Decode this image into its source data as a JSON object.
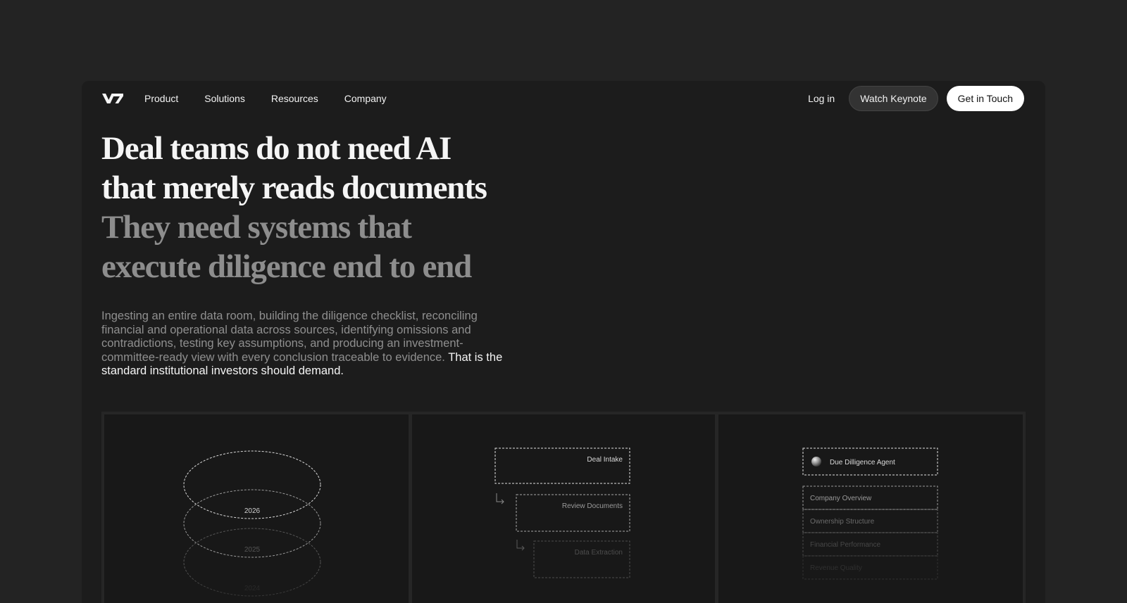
{
  "nav": {
    "logo_text": "V7",
    "links": [
      "Product",
      "Solutions",
      "Resources",
      "Company"
    ],
    "login": "Log in",
    "keynote": "Watch Keynote",
    "touch": "Get in Touch"
  },
  "hero": {
    "headline_primary_1": "Deal teams do not need AI",
    "headline_primary_2": "that merely reads documents",
    "headline_secondary_1": "They need systems that",
    "headline_secondary_2": "execute diligence end to end",
    "paragraph": "Ingesting an entire data room, building the diligence checklist, reconciling financial and operational data across sources, identifying omissions and contradictions, testing key assumptions, and producing an investment-committee-ready view with every conclusion traceable to evidence.",
    "paragraph_emphasis": "That is the standard institutional investors should demand."
  },
  "cards": {
    "years": [
      "2026",
      "2025",
      "2024"
    ],
    "steps": [
      "Deal Intake",
      "Review Documents",
      "Data Extraction"
    ],
    "agent": "Due Dilligence Agent",
    "sections": [
      "Company Overview",
      "Ownership Structure",
      "Financial Performance",
      "Revenue Quality"
    ]
  },
  "colors": {
    "page_bg": "#232323",
    "frame_bg": "#1c1c1c",
    "card_bg": "#181818",
    "primary_text": "#f5f5f5",
    "muted_text": "#8d8d8d",
    "button_light": "#ffffff"
  }
}
